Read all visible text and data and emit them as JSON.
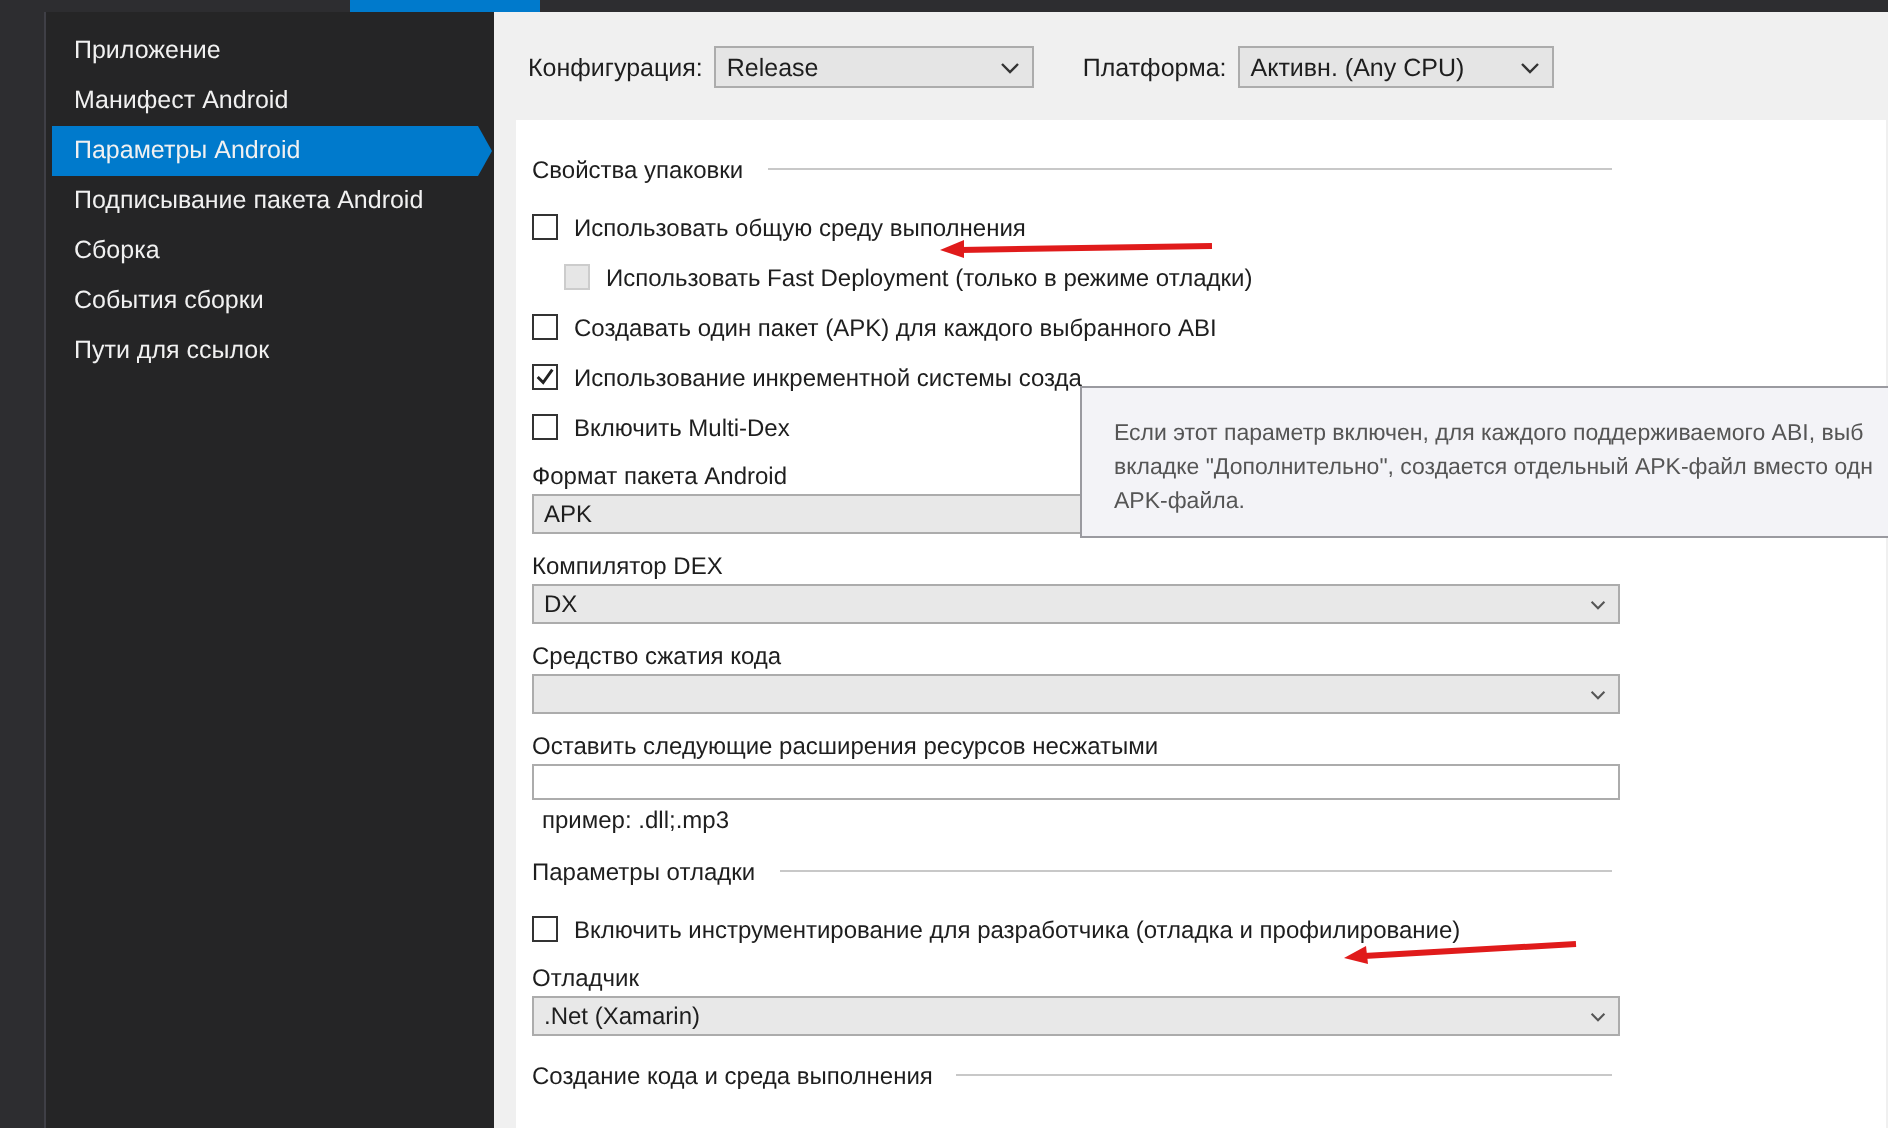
{
  "sidebar": {
    "items": [
      {
        "label": "Приложение",
        "selected": false
      },
      {
        "label": "Манифест Android",
        "selected": false
      },
      {
        "label": "Параметры Android",
        "selected": true
      },
      {
        "label": "Подписывание пакета Android",
        "selected": false
      },
      {
        "label": "Сборка",
        "selected": false
      },
      {
        "label": "События сборки",
        "selected": false
      },
      {
        "label": "Пути для ссылок",
        "selected": false
      }
    ]
  },
  "toolbar": {
    "configuration": {
      "label": "Конфигурация:",
      "value": "Release"
    },
    "platform": {
      "label": "Платформа:",
      "value": "Активн. (Any CPU)"
    }
  },
  "sections": [
    {
      "title": "Свойства упаковки",
      "items": [
        {
          "kind": "checkbox",
          "label": "Использовать общую среду выполнения",
          "checked": false,
          "disabled": false,
          "children": [
            {
              "kind": "checkbox",
              "label": "Использовать Fast Deployment (только в режиме отладки)",
              "checked": false,
              "disabled": true
            }
          ]
        },
        {
          "kind": "checkbox",
          "label": "Создавать один пакет (APK) для каждого выбранного ABI",
          "checked": false,
          "disabled": false
        },
        {
          "kind": "checkbox",
          "label": "Использование инкрементной системы созда",
          "checked": true,
          "disabled": false
        },
        {
          "kind": "checkbox",
          "label": "Включить Multi-Dex",
          "checked": false,
          "disabled": false
        },
        {
          "kind": "select",
          "label": "Формат пакета Android",
          "value": "APK"
        },
        {
          "kind": "select",
          "label": "Компилятор DEX",
          "value": "DX"
        },
        {
          "kind": "select",
          "label": "Средство сжатия кода",
          "value": ""
        },
        {
          "kind": "text",
          "label": "Оставить следующие расширения ресурсов несжатыми",
          "value": "",
          "hint": "пример: .dll;.mp3"
        }
      ]
    },
    {
      "title": "Параметры отладки",
      "items": [
        {
          "kind": "checkbox",
          "label": "Включить инструментирование для разработчика (отладка и профилирование)",
          "checked": false,
          "disabled": false
        },
        {
          "kind": "select",
          "label": "Отладчик",
          "value": ".Net (Xamarin)"
        }
      ]
    },
    {
      "title": "Создание кода и среда выполнения"
    }
  ],
  "tooltip": {
    "lines": [
      "Если этот параметр включен, для каждого поддерживаемого ABI, выб",
      "вкладке \"Дополнительно\", создается отдельный APK-файл вместо одн",
      "APK-файла."
    ]
  }
}
